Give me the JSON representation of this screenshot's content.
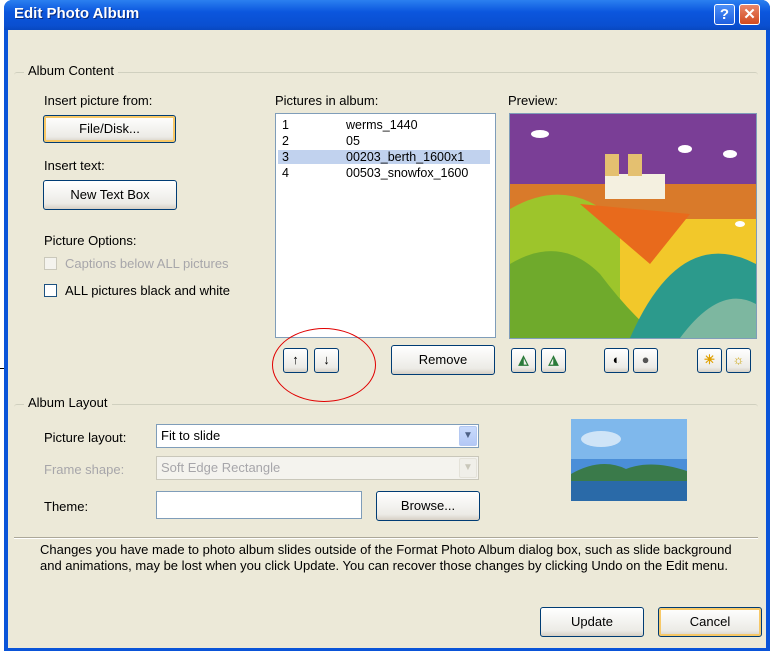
{
  "window": {
    "title": "Edit Photo Album",
    "help_glyph": "?",
    "close_glyph": "✕"
  },
  "album_content": {
    "legend": "Album Content",
    "insert_picture_label": "Insert picture from:",
    "file_disk_button": "File/Disk...",
    "insert_text_label": "Insert text:",
    "new_text_box_button": "New Text Box",
    "picture_options_label": "Picture Options:",
    "captions_option": "Captions below ALL pictures",
    "black_white_option": "ALL pictures black and white",
    "pictures_label": "Pictures in album:",
    "pictures": [
      {
        "num": "1",
        "name": "werms_1440"
      },
      {
        "num": "2",
        "name": "05"
      },
      {
        "num": "3",
        "name": "00203_berth_1600x1"
      },
      {
        "num": "4",
        "name": "00503_snowfox_1600"
      }
    ],
    "selected_index": 3,
    "move_up_glyph": "↑",
    "move_down_glyph": "↓",
    "remove_button": "Remove",
    "preview_label": "Preview:"
  },
  "album_layout": {
    "legend": "Album Layout",
    "picture_layout_label": "Picture layout:",
    "picture_layout_value": "Fit to slide",
    "frame_shape_label": "Frame shape:",
    "frame_shape_value": "Soft Edge Rectangle",
    "theme_label": "Theme:",
    "theme_value": "",
    "browse_button": "Browse..."
  },
  "footer": {
    "notice": "Changes you have made to photo album slides outside of the Format Photo Album dialog box, such as slide background and animations, may be lost when you click Update. You can recover those changes by clicking Undo on the Edit menu.",
    "update_button": "Update",
    "cancel_button": "Cancel"
  },
  "colors": {
    "title_bar": "#0a54d8",
    "dialog_face": "#ece9d8",
    "selection": "#c1d2ee",
    "annotation": "#e00000"
  }
}
